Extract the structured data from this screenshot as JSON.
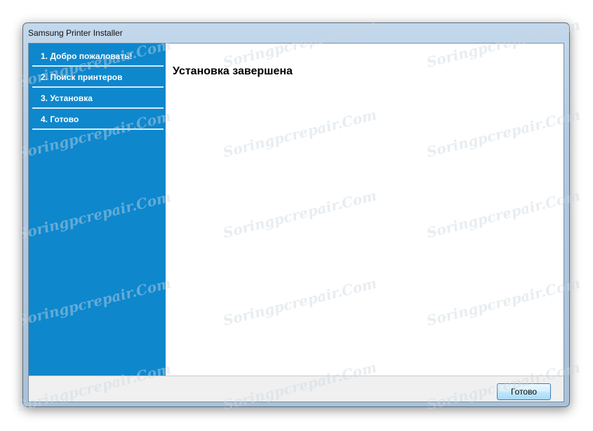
{
  "window": {
    "title": "Samsung Printer Installer"
  },
  "sidebar": {
    "items": [
      {
        "label": "1. Добро пожаловать!"
      },
      {
        "label": "2. Поиск принтеров"
      },
      {
        "label": "3. Установка"
      },
      {
        "label": "4. Готово"
      }
    ]
  },
  "main": {
    "title": "Установка завершена"
  },
  "footer": {
    "finish_label": "Готово"
  },
  "watermark": {
    "text": "Soringpcrepair.Com"
  },
  "colors": {
    "sidebar_bg": "#0e87cd",
    "sidebar_divider": "#d8eaf6",
    "window_frame": "#b2cbe3",
    "button_border": "#3c7fb1"
  }
}
